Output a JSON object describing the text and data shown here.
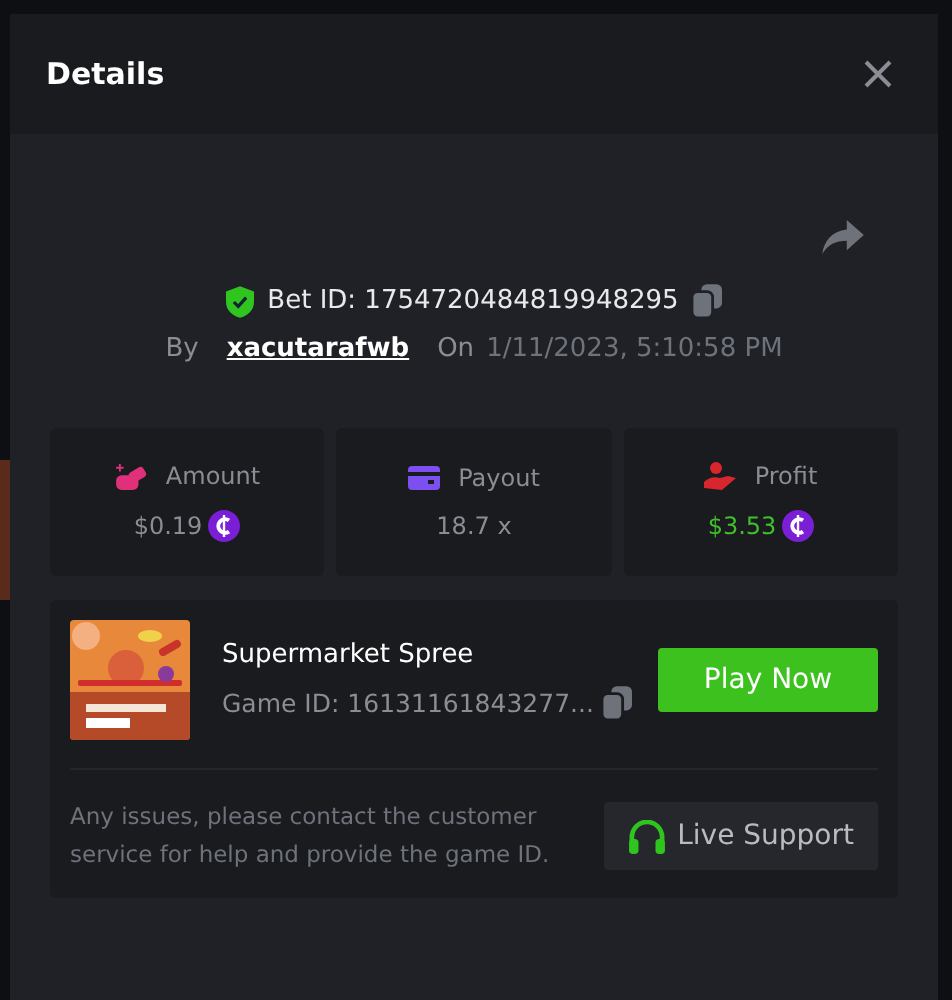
{
  "dialog": {
    "title": "Details"
  },
  "bet": {
    "verified": true,
    "label": "Bet ID: 1754720484819948295",
    "by_label": "By",
    "user": "xacutarafwb",
    "on_label": "On",
    "date": "1/11/2023, 5:10:58 PM"
  },
  "stats": [
    {
      "kind": "amount",
      "label": "Amount",
      "value": "$0.19",
      "coin": true,
      "color": "#e0307a",
      "positive": false
    },
    {
      "kind": "payout",
      "label": "Payout",
      "value": "18.7 x",
      "coin": false,
      "color": "#7b4ff0",
      "positive": false
    },
    {
      "kind": "profit",
      "label": "Profit",
      "value": "$3.53",
      "coin": true,
      "color": "#d8262f",
      "positive": true
    }
  ],
  "game": {
    "name": "Supermarket Spree",
    "id": "Game ID: 16131161843277...",
    "play_button": "Play Now"
  },
  "support": {
    "text": "Any issues, please contact the customer service for help and provide the game ID.",
    "button": "Live Support"
  }
}
